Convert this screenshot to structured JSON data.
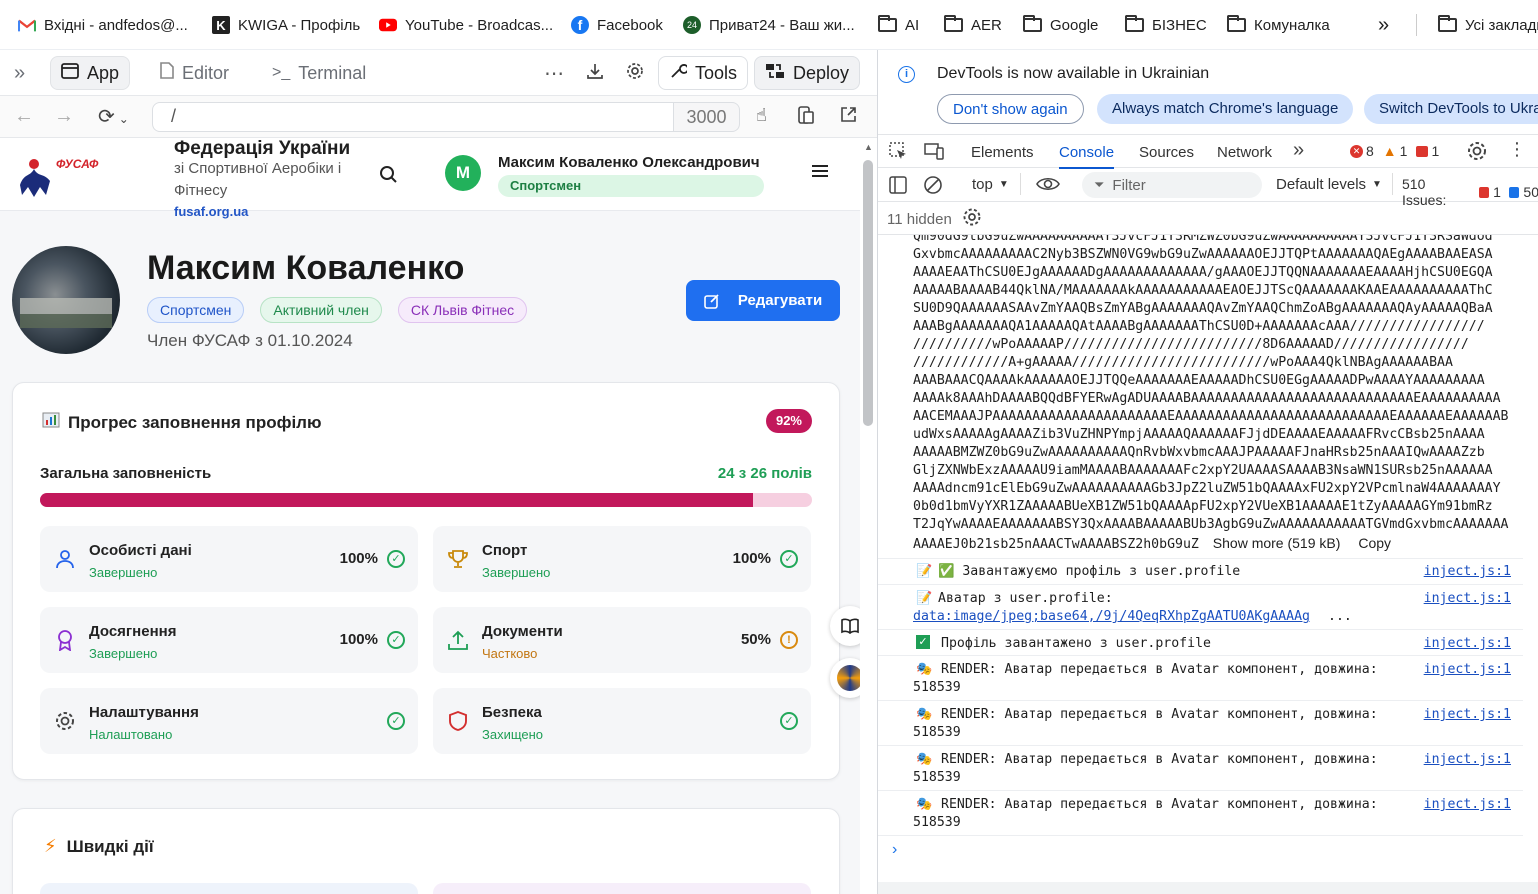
{
  "bookmarks": [
    {
      "label": "Вхідні - andfedos@...",
      "icon": "gmail-icon"
    },
    {
      "label": "KWIGA - Профіль",
      "icon": "kwiga-icon"
    },
    {
      "label": "YouTube - Broadcas...",
      "icon": "youtube-icon"
    },
    {
      "label": "Facebook",
      "icon": "facebook-icon"
    },
    {
      "label": "Приват24 - Ваш жи...",
      "icon": "privat24-icon"
    },
    {
      "label": "AI",
      "icon": "folder-icon"
    },
    {
      "label": "AER",
      "icon": "folder-icon"
    },
    {
      "label": "Google",
      "icon": "folder-icon"
    },
    {
      "label": "БІЗНЕС",
      "icon": "folder-icon"
    },
    {
      "label": "Комуналка",
      "icon": "folder-icon"
    },
    {
      "label": "Усі закладки",
      "icon": "folder-icon"
    }
  ],
  "toolbar": {
    "app": "App",
    "editor": "Editor",
    "terminal": "Terminal",
    "tools": "Tools",
    "deploy": "Deploy"
  },
  "urlbar": {
    "path": "/",
    "port": "3000"
  },
  "site": {
    "org_title": "Федерація України",
    "org_subtitle": "зі Спортивної Аеробіки і Фітнесу",
    "org_link": "fusaf.org.ua",
    "logo_text": "ФУСАФ",
    "user_initial": "M",
    "user_name": "Максим Коваленко Олександрович",
    "user_role": "Спортсмен"
  },
  "profile": {
    "name": "Максим Коваленко",
    "badges": [
      "Спортсмен",
      "Активний член",
      "СК Львів Фітнес"
    ],
    "member_since": "Член ФУСАФ з 01.10.2024",
    "edit_button": "Редагувати"
  },
  "progress": {
    "title": "Прогрес заповнення профілю",
    "percent_badge": "92%",
    "overall_label": "Загальна заповненість",
    "fields_label": "24 з 26 полів",
    "fill_fraction": 0.923,
    "colors": {
      "fill": "#c2185b",
      "track": "#f6cfe0"
    },
    "sections": [
      {
        "name": "Особисті дані",
        "status": "Завершено",
        "percent": "100%",
        "state": "done",
        "icon": "user-icon"
      },
      {
        "name": "Спорт",
        "status": "Завершено",
        "percent": "100%",
        "state": "done",
        "icon": "trophy-icon"
      },
      {
        "name": "Досягнення",
        "status": "Завершено",
        "percent": "100%",
        "state": "done",
        "icon": "award-icon"
      },
      {
        "name": "Документи",
        "status": "Частково",
        "percent": "50%",
        "state": "partial",
        "icon": "upload-icon"
      },
      {
        "name": "Налаштування",
        "status": "Налаштовано",
        "percent": "",
        "state": "done",
        "icon": "settings-icon"
      },
      {
        "name": "Безпека",
        "status": "Захищено",
        "percent": "",
        "state": "done",
        "icon": "shield-icon"
      }
    ]
  },
  "quick_actions": {
    "title": "Швидкі дії"
  },
  "devtools": {
    "banner": "DevTools is now available in Ukrainian",
    "banner_buttons": [
      "Don't show again",
      "Always match Chrome's language",
      "Switch DevTools to Ukrainian"
    ],
    "tabs": [
      "Elements",
      "Console",
      "Sources",
      "Network"
    ],
    "active_tab": "Console",
    "errors": "8",
    "warnings": "1",
    "issues_count": "1",
    "context": "top",
    "filter_placeholder": "Filter",
    "levels": "Default levels",
    "issues_label": "510 Issues:",
    "issues_err": "1",
    "issues_info": "50",
    "hidden": "11 hidden",
    "base64_lines": [
      "Qm90dG9tbG9uZwAAAAAAAAAAY3JvcFJ1Y3RMZWZ0bG9uZwAAAAAAAAAAY3JvcFJ1Y3RSaWdod",
      "GxvbmcAAAAAAAAAC2Nyb3BSZWN0VG9wbG9uZwAAAAAAOEJJTQPtAAAAAAAQAEgAAAABAAEASA",
      "AAAAEAAThCSU0EJgAAAAAADgAAAAAAAAAAAAA/gAAAOEJJTQQNAAAAAAAEAAAAHjhCSU0EGQA",
      "AAAAABAAAAB44QklNA/MAAAAAAAkAAAAAAAAAAAEAOEJJTScQAAAAAAAKAAEAAAAAAAAAAThC",
      "SU0D9QAAAAAASAAvZmYAAQBsZmYABgAAAAAAAQAvZmYAAQChmZoABgAAAAAAAQAyAAAAAQBaA",
      "AAABgAAAAAAAQA1AAAAAQAtAAAABgAAAAAAAThCSU0D+AAAAAAAcAAA/////////////////",
      "//////////wPoAAAAAP/////////////////////////8D6AAAAAD/////////////////",
      "////////////A+gAAAAA/////////////////////////wPoAAA4QklNBAgAAAAAABAA",
      "AAABAAACQAAAAkAAAAAAOEJJTQQeAAAAAAAEAAAAADhCSU0EGgAAAAADPwAAAAYAAAAAAAAA",
      "AAAAk8AAAhDAAAABQQdBFYERwAgADUAAAABAAAAAAAAAAAAAAAAAAAAAAAAAAAAEAAAAAAAAAA",
      "AACEMAAAJPAAAAAAAAAAAAAAAAAAAAAAEAAAAAAAAAAAAAAAAAAAAAAAAAAAEAAAAAAEAAAAAAB",
      "udWxsAAAAAgAAAAZib3VuZHNPYmpjAAAAAQAAAAAAFJjdDEAAAAEAAAAAFRvcCBsb25nAAAA",
      "AAAAABMZWZ0bG9uZwAAAAAAAAAAQnRvbWxvbmcAAAJPAAAAAFJnaHRsb25nAAAIQwAAAAZzb",
      "GljZXNWbExzAAAAAU9iamMAAAABAAAAAAAFc2xpY2UAAAASAAAAB3NsaWN1SURsb25nAAAAAA",
      "AAAAdncm91cElEbG9uZwAAAAAAAAAAGb3JpZ2luZW51bQAAAAxFU2xpY2VPcmlnaW4AAAAAAAY",
      "0b0d1bmVyYXR1ZAAAAABUeXB1ZW51bQAAAApFU2xpY2VUeXB1AAAAAE1tZyAAAAAGYm91bmRz",
      "T2JqYwAAAAEAAAAAAABSY3QxAAAABAAAAABUb3AgbG9uZwAAAAAAAAAAATGVmdGxvbmcAAAAAAA",
      "AAAAEJ0b21sb25nAAACTwAAAABSZ2h0bG9uZ"
    ],
    "show_more": "Show more (519 kB)",
    "copy": "Copy",
    "messages": [
      {
        "icon": "memo-icon",
        "text": "✅ Завантажуємо профіль з user.profile",
        "source": "inject.js:1"
      },
      {
        "icon": "memo-icon",
        "text": "Аватар з user.profile:",
        "link": "data:image/jpeg;base64,/9j/4QeqRXhpZgAATU0AKgAAAAg",
        "source": "inject.js:1"
      },
      {
        "icon": "check-icon",
        "text": "Профіль завантажено з user.profile",
        "source": "inject.js:1"
      },
      {
        "icon": "theater-icon",
        "text": "RENDER: Аватар передається в Avatar компонент, довжина:",
        "value": "518539",
        "source": "inject.js:1"
      },
      {
        "icon": "theater-icon",
        "text": "RENDER: Аватар передається в Avatar компонент, довжина:",
        "value": "518539",
        "source": "inject.js:1"
      },
      {
        "icon": "theater-icon",
        "text": "RENDER: Аватар передається в Avatar компонент, довжина:",
        "value": "518539",
        "source": "inject.js:1"
      },
      {
        "icon": "theater-icon",
        "text": "RENDER: Аватар передається в Avatar компонент, довжина:",
        "value": "518539",
        "source": "inject.js:1"
      }
    ]
  }
}
